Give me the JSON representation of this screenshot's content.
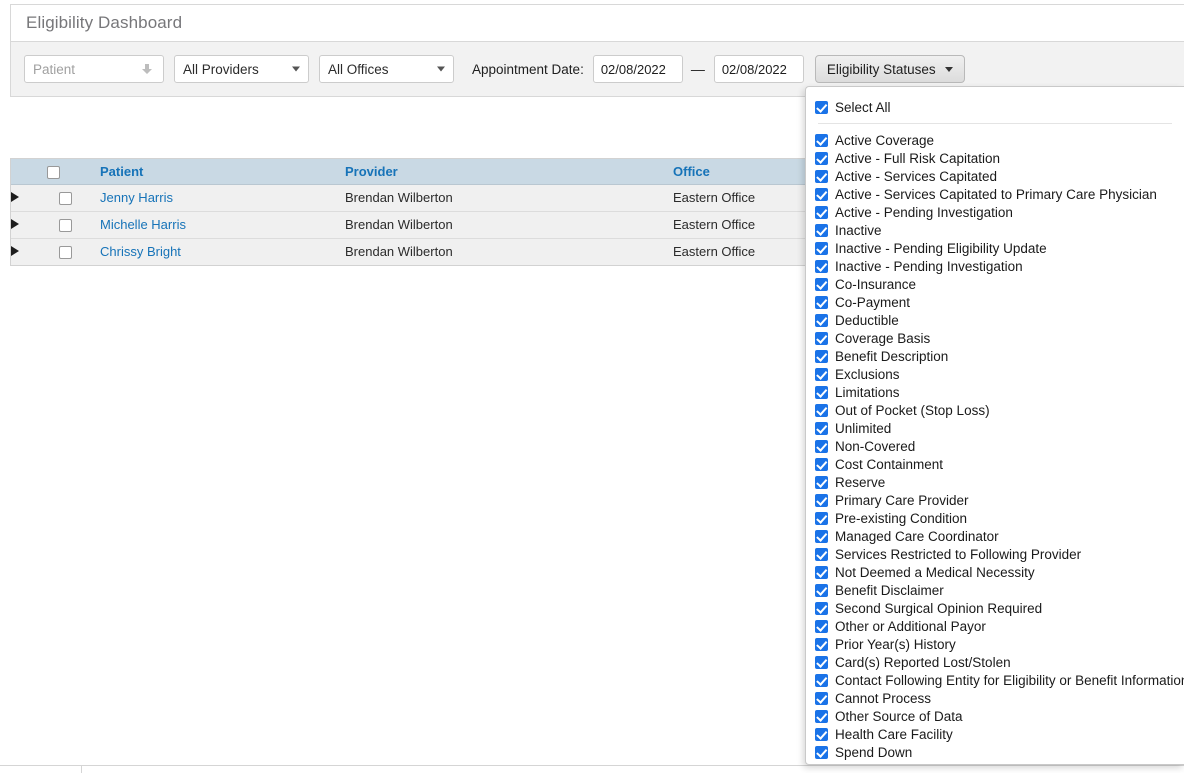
{
  "window": {
    "title": "Eligibility Dashboard"
  },
  "filters": {
    "patient": {
      "placeholder": "Patient",
      "value": "",
      "icon": "down-arrow-icon"
    },
    "providers": {
      "selected": "All Providers"
    },
    "offices": {
      "selected": "All Offices"
    },
    "appointment_date": {
      "label": "Appointment Date:",
      "from": "02/08/2022",
      "separator": "—",
      "to": "02/08/2022"
    },
    "eligibility_statuses_button": {
      "label": "Eligibility Statuses",
      "expanded": true
    }
  },
  "table": {
    "columns": [
      "",
      "",
      "Patient",
      "Provider",
      "Office"
    ],
    "header_checkbox_checked": false,
    "rows": [
      {
        "expanded": false,
        "checked": false,
        "patient": "Jenny Harris",
        "provider": "Brendan Wilberton",
        "office": "Eastern Office"
      },
      {
        "expanded": false,
        "checked": false,
        "patient": "Michelle Harris",
        "provider": "Brendan Wilberton",
        "office": "Eastern Office"
      },
      {
        "expanded": false,
        "checked": false,
        "patient": "Chrissy Bright",
        "provider": "Brendan Wilberton",
        "office": "Eastern Office"
      }
    ]
  },
  "dropdown": {
    "select_all": {
      "label": "Select All",
      "checked": true
    },
    "items": [
      {
        "label": "Active Coverage",
        "checked": true
      },
      {
        "label": "Active - Full Risk Capitation",
        "checked": true
      },
      {
        "label": "Active - Services Capitated",
        "checked": true
      },
      {
        "label": "Active - Services Capitated to Primary Care Physician",
        "checked": true
      },
      {
        "label": "Active - Pending Investigation",
        "checked": true
      },
      {
        "label": "Inactive",
        "checked": true
      },
      {
        "label": "Inactive - Pending Eligibility Update",
        "checked": true
      },
      {
        "label": "Inactive - Pending Investigation",
        "checked": true
      },
      {
        "label": "Co-Insurance",
        "checked": true
      },
      {
        "label": "Co-Payment",
        "checked": true
      },
      {
        "label": "Deductible",
        "checked": true
      },
      {
        "label": "Coverage Basis",
        "checked": true
      },
      {
        "label": "Benefit Description",
        "checked": true
      },
      {
        "label": "Exclusions",
        "checked": true
      },
      {
        "label": "Limitations",
        "checked": true
      },
      {
        "label": "Out of Pocket (Stop Loss)",
        "checked": true
      },
      {
        "label": "Unlimited",
        "checked": true
      },
      {
        "label": "Non-Covered",
        "checked": true
      },
      {
        "label": "Cost Containment",
        "checked": true
      },
      {
        "label": "Reserve",
        "checked": true
      },
      {
        "label": "Primary Care Provider",
        "checked": true
      },
      {
        "label": "Pre-existing Condition",
        "checked": true
      },
      {
        "label": "Managed Care Coordinator",
        "checked": true
      },
      {
        "label": "Services Restricted to Following Provider",
        "checked": true
      },
      {
        "label": "Not Deemed a Medical Necessity",
        "checked": true
      },
      {
        "label": "Benefit Disclaimer",
        "checked": true
      },
      {
        "label": "Second Surgical Opinion Required",
        "checked": true
      },
      {
        "label": "Other or Additional Payor",
        "checked": true
      },
      {
        "label": "Prior Year(s) History",
        "checked": true
      },
      {
        "label": "Card(s) Reported Lost/Stolen",
        "checked": true
      },
      {
        "label": "Contact Following Entity for Eligibility or Benefit Information",
        "checked": true
      },
      {
        "label": "Cannot Process",
        "checked": true
      },
      {
        "label": "Other Source of Data",
        "checked": true
      },
      {
        "label": "Health Care Facility",
        "checked": true
      },
      {
        "label": "Spend Down",
        "checked": true
      }
    ]
  },
  "colors": {
    "link": "#1673b8",
    "header_bg": "#c9d9e4",
    "checkbox_checked": "#1a73e8",
    "row_bg": "#f0f0f0",
    "filterbar_bg": "#f2f2f2"
  }
}
